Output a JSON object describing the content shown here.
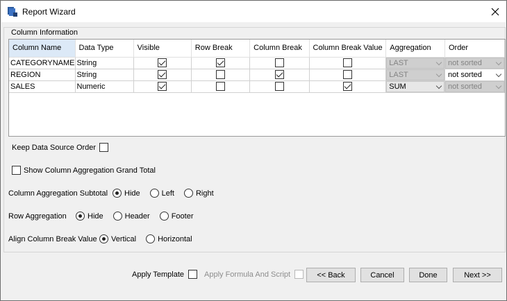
{
  "window": {
    "title": "Report Wizard"
  },
  "group": {
    "title": "Column Information"
  },
  "table": {
    "headers": [
      "Column Name",
      "Data Type",
      "Visible",
      "Row Break",
      "Column Break",
      "Column Break Value",
      "Aggregation",
      "Order"
    ],
    "rows": [
      {
        "name": "CATEGORYNAME",
        "type": "String",
        "visible": true,
        "row_break": true,
        "col_break": false,
        "col_break_value": false,
        "aggregation": "LAST",
        "aggregation_enabled": false,
        "order": "not sorted",
        "order_enabled": false
      },
      {
        "name": "REGION",
        "type": "String",
        "visible": true,
        "row_break": false,
        "col_break": true,
        "col_break_value": false,
        "aggregation": "LAST",
        "aggregation_enabled": false,
        "order": "not sorted",
        "order_enabled": true
      },
      {
        "name": "SALES",
        "type": "Numeric",
        "visible": true,
        "row_break": false,
        "col_break": false,
        "col_break_value": true,
        "aggregation": "SUM",
        "aggregation_enabled": true,
        "order": "not sorted",
        "order_enabled": false
      }
    ]
  },
  "options": {
    "keep_order_label": "Keep Data Source Order",
    "grand_total_label": "Show Column Aggregation Grand Total",
    "subtotal": {
      "label": "Column Aggregation Subtotal",
      "choices": [
        "Hide",
        "Left",
        "Right"
      ],
      "selected": "Hide"
    },
    "row_agg": {
      "label": "Row Aggregation",
      "choices": [
        "Hide",
        "Header",
        "Footer"
      ],
      "selected": "Hide"
    },
    "align": {
      "label": "Align Column Break Value",
      "choices": [
        "Vertical",
        "Horizontal"
      ],
      "selected": "Vertical"
    }
  },
  "footer": {
    "apply_template_label": "Apply Template",
    "apply_formula_label": "Apply Formula And Script",
    "back_label": "<< Back",
    "cancel_label": "Cancel",
    "done_label": "Done",
    "next_label": "Next >>"
  },
  "colors": {
    "header_selected": "#dce9f7",
    "window_bg": "#f0f0f0",
    "disabled_combo": "#cfcfcf"
  },
  "icons": {
    "app": "report-wizard-icon",
    "close": "close-icon"
  }
}
